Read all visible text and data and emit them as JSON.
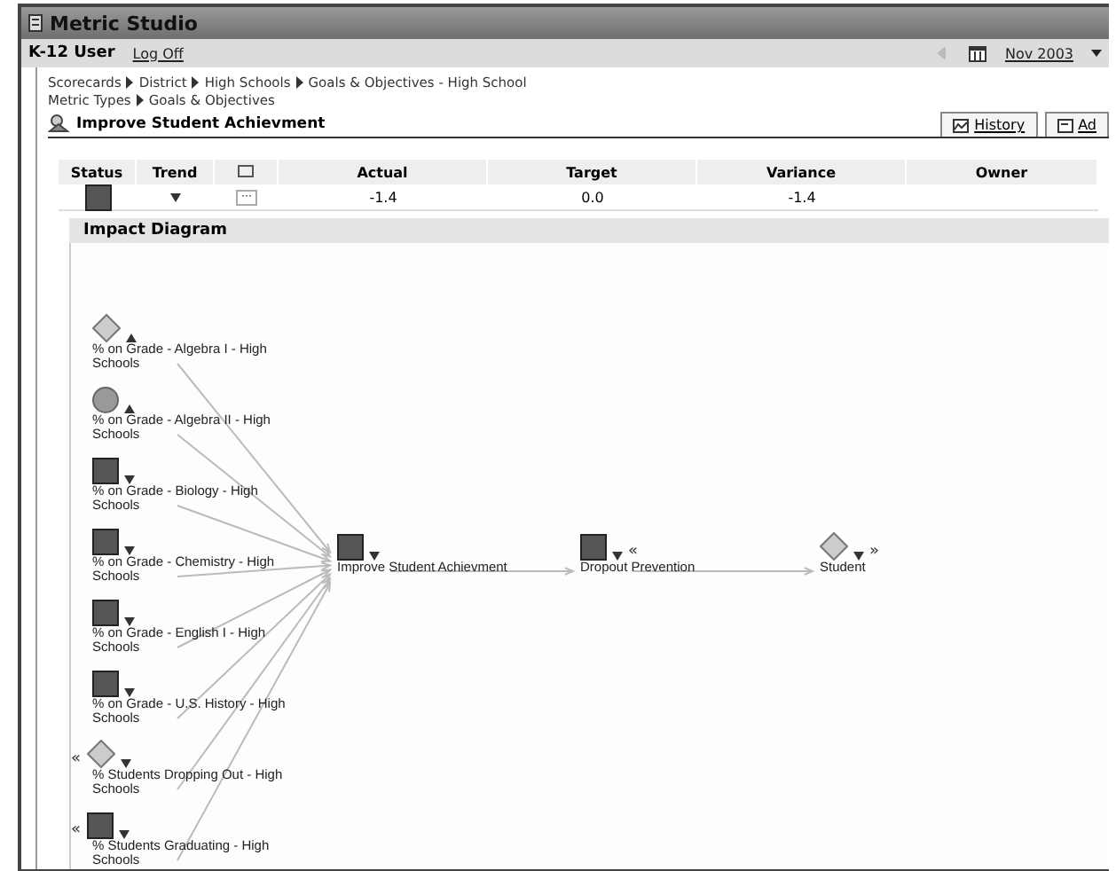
{
  "window": {
    "title": "Metric Studio"
  },
  "user_bar": {
    "user": "K-12 User",
    "logoff": "Log Off",
    "period": "Nov 2003"
  },
  "breadcrumbs": [
    [
      "Scorecards",
      "District",
      "High Schools",
      "Goals & Objectives - High School"
    ],
    [
      "Metric Types",
      "Goals & Objectives"
    ]
  ],
  "metric": {
    "title": "Improve Student Achievment",
    "tabs": [
      "History",
      "Ad"
    ]
  },
  "table": {
    "columns": [
      "Status",
      "Trend",
      "Actual",
      "Target",
      "Variance",
      "Owner"
    ],
    "row": {
      "status": {
        "kind": "square"
      },
      "trend": {
        "up": false
      },
      "comment": "···",
      "actual": "-1.4",
      "target": "0.0",
      "variance": "-1.4"
    }
  },
  "diagram": {
    "title": "Impact Diagram",
    "sources": [
      {
        "label": "% on Grade - Algebra I - High Schools",
        "kind": "diamond",
        "up": true
      },
      {
        "label": "% on Grade - Algebra II - High Schools",
        "kind": "circle",
        "up": true
      },
      {
        "label": "% on Grade - Biology - High Schools",
        "kind": "square",
        "up": false
      },
      {
        "label": "% on Grade - Chemistry - High Schools",
        "kind": "square",
        "up": false
      },
      {
        "label": "% on Grade - English I - High Schools",
        "kind": "square",
        "up": false
      },
      {
        "label": "% on Grade - U.S. History - High Schools",
        "kind": "square",
        "up": false
      },
      {
        "label": "% Students Dropping Out - High Schools",
        "kind": "diamond",
        "up": false,
        "before": "«"
      },
      {
        "label": "% Students Graduating - High Schools",
        "kind": "square",
        "up": false,
        "before": "«"
      }
    ],
    "chain": [
      {
        "label": "Improve Student Achievment",
        "kind": "square",
        "up": false
      },
      {
        "label": "Dropout Prevention",
        "kind": "square",
        "up": false,
        "after": "«"
      },
      {
        "label": "Student",
        "kind": "diamond",
        "up": false,
        "after": "»"
      }
    ]
  }
}
